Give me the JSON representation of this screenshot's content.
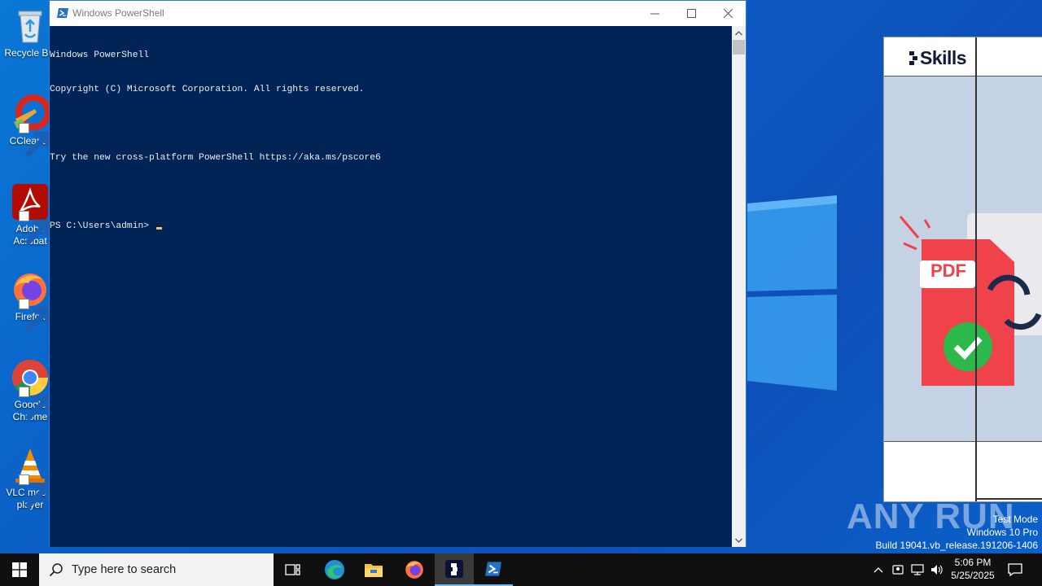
{
  "desktop": {
    "icons": [
      {
        "label": "Recycle Bin",
        "icon": "recycle-bin-icon"
      },
      {
        "label": "CCleaner",
        "icon": "ccleaner-icon"
      },
      {
        "label": "Adobe Acrobat",
        "icon": "adobe-acrobat-icon"
      },
      {
        "label": "Firefox",
        "icon": "firefox-icon"
      },
      {
        "label": "Google Chrome",
        "icon": "chrome-icon"
      },
      {
        "label": "VLC media player",
        "icon": "vlc-icon"
      }
    ],
    "watermark": "ANY RUN",
    "test_mode": {
      "line1": "Test Mode",
      "line2": "Windows 10 Pro",
      "line3": "Build 19041.vb_release.191206-1406"
    }
  },
  "powershell": {
    "title": "Windows PowerShell",
    "lines": [
      "Windows PowerShell",
      "Copyright (C) Microsoft Corporation. All rights reserved.",
      "",
      "Try the new cross-platform PowerShell https://aka.ms/pscore6",
      "",
      "PS C:\\Users\\admin> "
    ],
    "colors": {
      "background": "#012456",
      "text": "#eeedf0"
    }
  },
  "skills_window": {
    "logo_text": "Skills",
    "badge_text": "PDF"
  },
  "taskbar": {
    "search_placeholder": "Type here to search",
    "apps": [
      "task-view-icon",
      "edge-icon",
      "file-explorer-icon",
      "firefox-icon",
      "skills-app-icon",
      "powershell-icon"
    ],
    "clock_time": "5:06 PM",
    "clock_date": "5/25/2025",
    "accent": "#76b9ed"
  }
}
